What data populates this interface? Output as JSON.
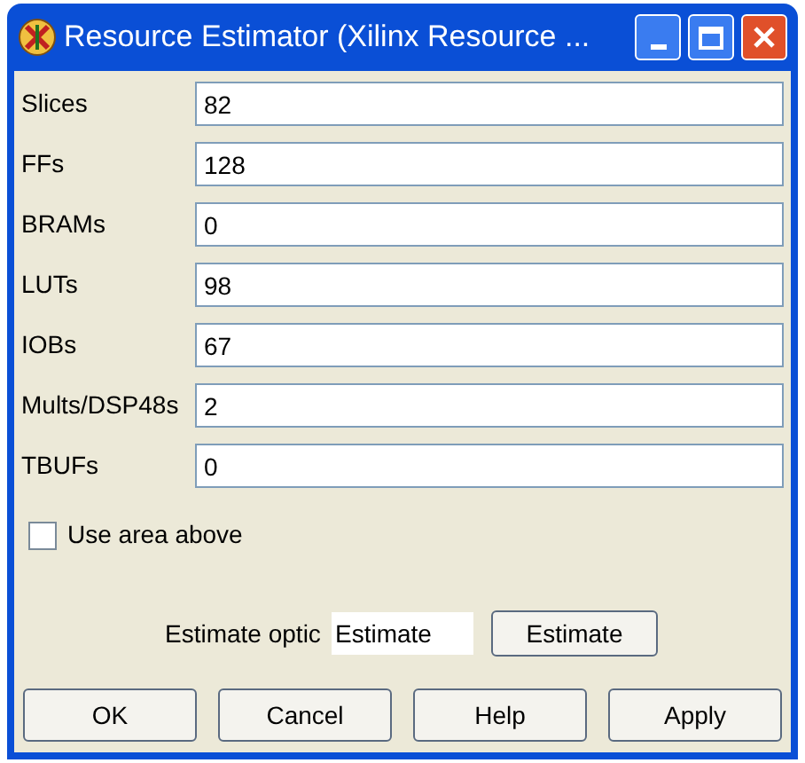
{
  "window": {
    "title": "Resource Estimator (Xilinx Resource ..."
  },
  "fields": [
    {
      "label": "Slices",
      "value": "82"
    },
    {
      "label": "FFs",
      "value": "128"
    },
    {
      "label": "BRAMs",
      "value": "0"
    },
    {
      "label": "LUTs",
      "value": "98"
    },
    {
      "label": "IOBs",
      "value": "67"
    },
    {
      "label": "Mults/DSP48s",
      "value": "2"
    },
    {
      "label": "TBUFs",
      "value": "0"
    }
  ],
  "use_area_checkbox": {
    "label": "Use area above",
    "checked": false
  },
  "estimate": {
    "label": "Estimate optic",
    "value": "Estimate",
    "button": "Estimate"
  },
  "buttons": [
    "OK",
    "Cancel",
    "Help",
    "Apply"
  ]
}
